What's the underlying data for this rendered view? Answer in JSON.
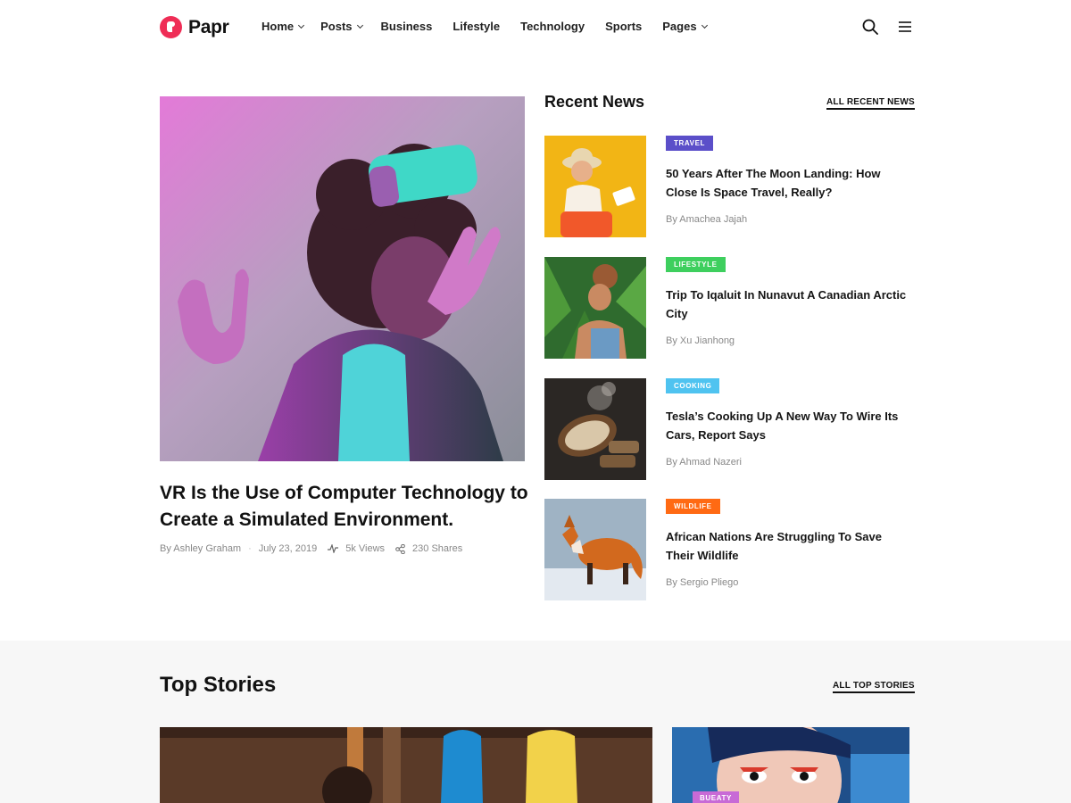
{
  "brand": {
    "name": "Papr",
    "accent": "#ef2d56"
  },
  "nav": {
    "items": [
      {
        "label": "Home",
        "has_dropdown": true
      },
      {
        "label": "Posts",
        "has_dropdown": true
      },
      {
        "label": "Business",
        "has_dropdown": false
      },
      {
        "label": "Lifestyle",
        "has_dropdown": false
      },
      {
        "label": "Technology",
        "has_dropdown": false
      },
      {
        "label": "Sports",
        "has_dropdown": false
      },
      {
        "label": "Pages",
        "has_dropdown": true
      }
    ],
    "icons": [
      "search-icon",
      "menu-icon"
    ]
  },
  "hero": {
    "title": "VR Is the Use of Computer Technology to Create a Simulated Environment.",
    "author": "By Ashley Graham",
    "date": "July 23, 2019",
    "views": "5k Views",
    "shares": "230 Shares"
  },
  "recent": {
    "heading": "Recent News",
    "link": "ALL RECENT NEWS",
    "items": [
      {
        "category": "TRAVEL",
        "color": "#5b4fc9",
        "title": "50 Years After The Moon Landing: How Close Is Space Travel, Really?",
        "author": "By Amachea Jajah"
      },
      {
        "category": "LIFESTYLE",
        "color": "#3ecf5e",
        "title": "Trip To Iqaluit In Nunavut A Canadian Arctic City",
        "author": "By Xu Jianhong"
      },
      {
        "category": "COOKING",
        "color": "#4fc3f0",
        "title": "Tesla’s Cooking Up A New Way To Wire Its Cars, Report Says",
        "author": "By Ahmad Nazeri"
      },
      {
        "category": "WILDLIFE",
        "color": "#ff6a13",
        "title": "African Nations Are Struggling To Save Their Wildlife",
        "author": "By Sergio Pliego"
      }
    ]
  },
  "top_stories": {
    "heading": "Top Stories",
    "link": "ALL TOP STORIES",
    "badge": "BUEATY",
    "badge_color": "#c86ad6"
  }
}
